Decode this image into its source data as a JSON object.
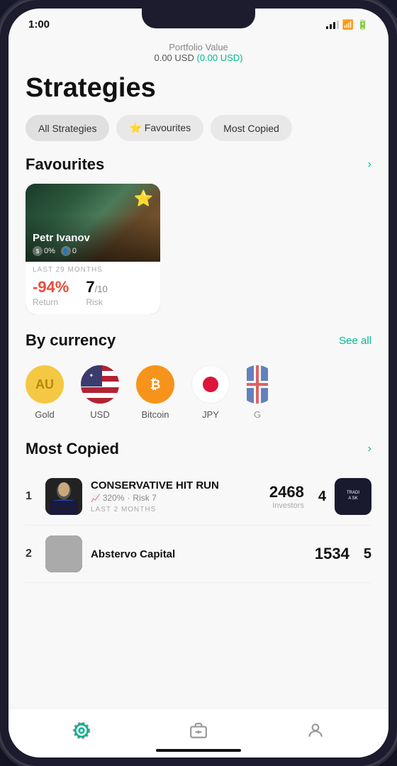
{
  "statusBar": {
    "time": "1:00",
    "timeIcon": "location-arrow"
  },
  "portfolio": {
    "label": "Portfolio Value",
    "value": "0.00 USD",
    "change": "(0.00 USD)"
  },
  "page": {
    "title": "Strategies"
  },
  "filterTabs": [
    {
      "id": "all",
      "label": "All Strategies",
      "active": true
    },
    {
      "id": "favourites",
      "label": "⭐ Favourites",
      "active": false
    },
    {
      "id": "mostCopied",
      "label": "Most Copied",
      "active": false
    }
  ],
  "favourites": {
    "sectionTitle": "Favourites",
    "seeMoreIcon": "chevron-right",
    "strategies": [
      {
        "name": "Petr Ivanov",
        "profit": "0%",
        "investors": "0",
        "starred": true,
        "period": "LAST 29 MONTHS",
        "return": "-94%",
        "risk": "7",
        "riskMax": "10",
        "returnLabel": "Return",
        "riskLabel": "Risk"
      }
    ]
  },
  "byCurrency": {
    "sectionTitle": "By currency",
    "seeAllLabel": "See all",
    "currencies": [
      {
        "id": "gold",
        "label": "Gold",
        "symbol": "AU",
        "type": "gold"
      },
      {
        "id": "usd",
        "label": "USD",
        "type": "usd"
      },
      {
        "id": "btc",
        "label": "Bitcoin",
        "symbol": "₿",
        "type": "btc"
      },
      {
        "id": "jpy",
        "label": "JPY",
        "type": "jpy"
      },
      {
        "id": "gbp",
        "label": "G",
        "type": "gbp"
      }
    ]
  },
  "mostCopied": {
    "sectionTitle": "Most Copied",
    "seeMoreIcon": "chevron-right",
    "items": [
      {
        "rank": "1",
        "rankRight": "4",
        "name": "CONSERVATIVE HIT RUN",
        "return": "320%",
        "risk": "7",
        "period": "LAST 2 MONTHS",
        "investors": "2468",
        "investorsLabel": "Investors",
        "thumbText": "TRADI\nA SK"
      },
      {
        "rank": "2",
        "rankRight": "5",
        "name": "Abstervo Capital",
        "return": "",
        "risk": "",
        "period": "",
        "investors": "1534",
        "investorsLabel": ""
      }
    ]
  },
  "bottomNav": [
    {
      "id": "strategies",
      "icon": "strategies",
      "active": true
    },
    {
      "id": "portfolio",
      "icon": "briefcase",
      "active": false
    },
    {
      "id": "profile",
      "icon": "user",
      "active": false
    }
  ]
}
